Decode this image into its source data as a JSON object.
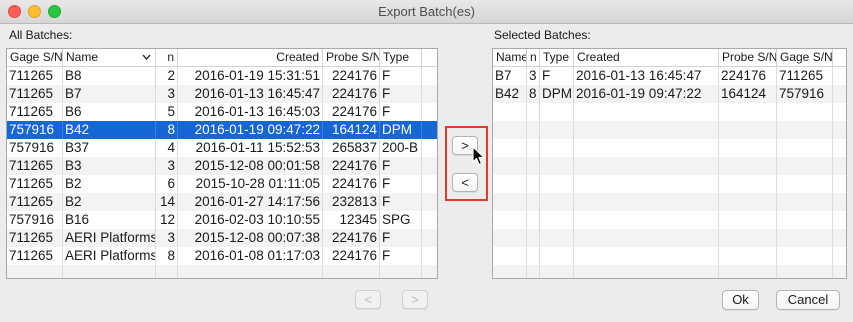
{
  "window": {
    "title": "Export Batch(es)"
  },
  "all_batches": {
    "label": "All Batches:",
    "columns": [
      {
        "label": "Gage S/N"
      },
      {
        "label": "Name"
      },
      {
        "label": "n"
      },
      {
        "label": "Created"
      },
      {
        "label": "Probe S/N"
      },
      {
        "label": "Type"
      }
    ],
    "sorted_column_icon": "chevron-down-icon",
    "rows": [
      {
        "gage": "711265",
        "name": "B8",
        "n": "2",
        "created": "2016-01-19 15:31:51",
        "probe": "224176",
        "type": "F",
        "selected": false
      },
      {
        "gage": "711265",
        "name": "B7",
        "n": "3",
        "created": "2016-01-13 16:45:47",
        "probe": "224176",
        "type": "F",
        "selected": false
      },
      {
        "gage": "711265",
        "name": "B6",
        "n": "5",
        "created": "2016-01-13 16:45:03",
        "probe": "224176",
        "type": "F",
        "selected": false
      },
      {
        "gage": "757916",
        "name": "B42",
        "n": "8",
        "created": "2016-01-19 09:47:22",
        "probe": "164124",
        "type": "DPM",
        "selected": true
      },
      {
        "gage": "757916",
        "name": "B37",
        "n": "4",
        "created": "2016-01-11 15:52:53",
        "probe": "265837",
        "type": "200-B",
        "selected": false
      },
      {
        "gage": "711265",
        "name": "B3",
        "n": "3",
        "created": "2015-12-08 00:01:58",
        "probe": "224176",
        "type": "F",
        "selected": false
      },
      {
        "gage": "711265",
        "name": "B2",
        "n": "6",
        "created": "2015-10-28 01:11:05",
        "probe": "224176",
        "type": "F",
        "selected": false
      },
      {
        "gage": "711265",
        "name": "B2",
        "n": "14",
        "created": "2016-01-27 14:17:56",
        "probe": "232813",
        "type": "F",
        "selected": false
      },
      {
        "gage": "757916",
        "name": "B16",
        "n": "12",
        "created": "2016-02-03 10:10:55",
        "probe": "12345",
        "type": "SPG",
        "selected": false
      },
      {
        "gage": "711265",
        "name": "AERI Platforms",
        "n": "3",
        "created": "2015-12-08 00:07:38",
        "probe": "224176",
        "type": "F",
        "selected": false
      },
      {
        "gage": "711265",
        "name": "AERI Platforms",
        "n": "8",
        "created": "2016-01-08 01:17:03",
        "probe": "224176",
        "type": "F",
        "selected": false
      }
    ],
    "prev_page_label": "<",
    "next_page_label": ">"
  },
  "transfer": {
    "add_label": ">",
    "remove_label": "<"
  },
  "selected_batches": {
    "label": "Selected Batches:",
    "columns": [
      {
        "label": "Name"
      },
      {
        "label": "n"
      },
      {
        "label": "Type"
      },
      {
        "label": "Created"
      },
      {
        "label": "Probe S/N"
      },
      {
        "label": "Gage S/N"
      }
    ],
    "rows": [
      {
        "name": "B7",
        "n": "3",
        "type": "F",
        "created": "2016-01-13 16:45:47",
        "probe": "224176",
        "gage": "711265"
      },
      {
        "name": "B42",
        "n": "8",
        "type": "DPM",
        "created": "2016-01-19 09:47:22",
        "probe": "164124",
        "gage": "757916"
      }
    ]
  },
  "dialog": {
    "ok_label": "Ok",
    "cancel_label": "Cancel"
  },
  "colors": {
    "selection": "#1566d6",
    "focus_highlight": "#e13a2b"
  }
}
